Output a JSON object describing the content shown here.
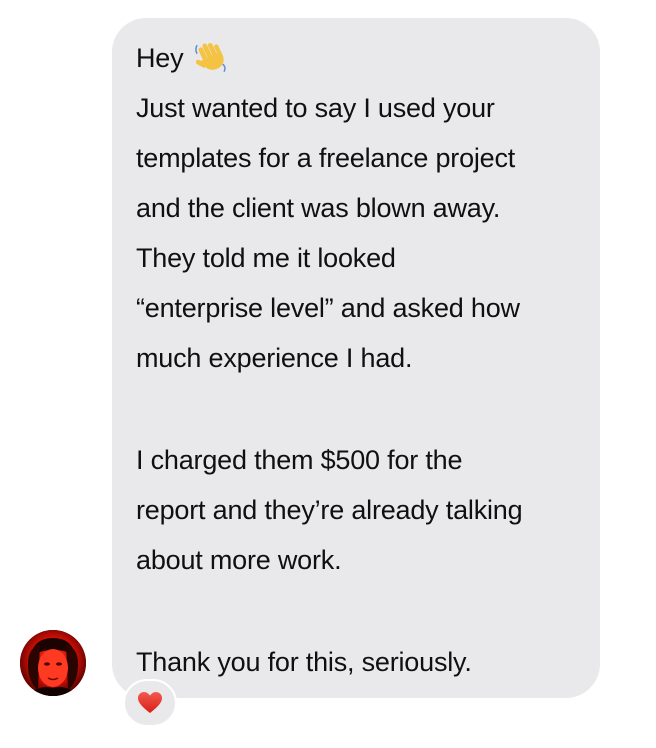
{
  "message": {
    "greeting": "Hey",
    "greeting_emoji": "waving-hand-icon",
    "lines": [
      "Just wanted to say I used your",
      "templates for a freelance project",
      "and the client was blown away.",
      "They told me it looked",
      "“enterprise level” and asked how",
      "much experience I had.",
      "I charged them $500 for the",
      "report and they’re already talking",
      "about more work.",
      "Thank you for this, seriously."
    ]
  },
  "reaction": {
    "icon": "heart-icon",
    "color": "#e0281e"
  },
  "sender": {
    "avatar": "avatar"
  },
  "colors": {
    "bubble": "#e9e9eb",
    "text": "#101010"
  }
}
